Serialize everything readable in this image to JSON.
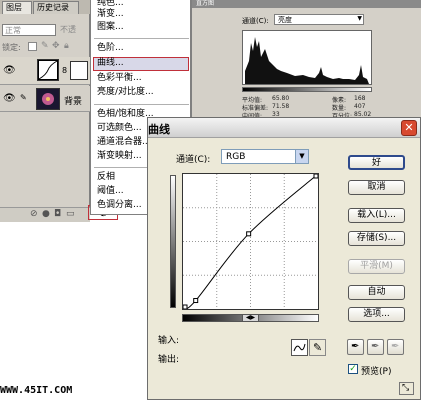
{
  "layers_panel": {
    "tab_layers": "图层",
    "tab_history": "历史记录",
    "blend_mode": "正常",
    "opacity_label": "不透",
    "lock_label": "锁定:",
    "background_layer_name": "背景"
  },
  "adjust_menu": {
    "items": [
      "纯色...",
      "渐变...",
      "图案...",
      "色阶...",
      "曲线...",
      "色彩平衡...",
      "亮度/对比度...",
      "色相/饱和度...",
      "可选颜色...",
      "通道混合器...",
      "渐变映射...",
      "反相",
      "阈值...",
      "色调分离..."
    ],
    "highlighted_item": "曲线..."
  },
  "histogram_panel": {
    "title": "直方图",
    "channel_label": "通道(C):",
    "channel_value": "亮度",
    "stats": {
      "mean_label": "平均值:",
      "mean": "65.80",
      "std_label": "标准偏差:",
      "std": "71.58",
      "median_label": "中间值:",
      "median": "33",
      "pixels_label": "像素:",
      "pixels": "168",
      "count_label": "数量:",
      "count": "407",
      "percent_label": "百分位:",
      "percent": "85.02"
    }
  },
  "curves_dialog": {
    "title": "曲线",
    "channel_label": "通道(C):",
    "channel_value": "RGB",
    "input_label": "输入:",
    "output_label": "输出:",
    "buttons": {
      "ok": "好",
      "cancel": "取消",
      "load": "载入(L)...",
      "save": "存储(S)...",
      "smooth": "平滑(M)",
      "auto": "自动",
      "options": "选项..."
    },
    "preview_label": "预览(P)",
    "preview_checked": true,
    "curve_points": [
      [
        0,
        0
      ],
      [
        24,
        16
      ],
      [
        124,
        142
      ],
      [
        255,
        255
      ]
    ]
  },
  "watermark": "WWW.45IT.COM",
  "colors": {
    "menu_highlight_border": "#c0303a",
    "close_button": "#d8492f",
    "default_button_border": "#2e4a8c"
  }
}
